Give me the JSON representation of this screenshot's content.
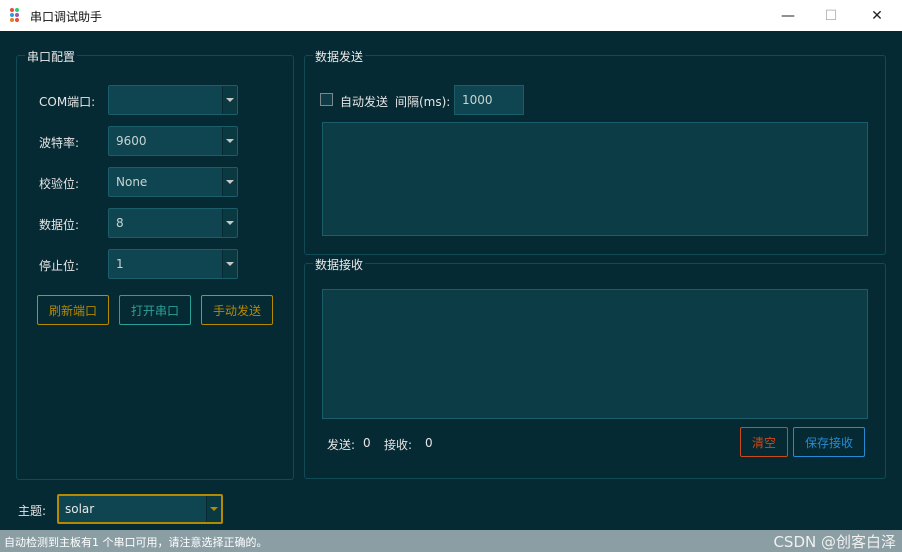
{
  "window": {
    "title": "串口调试助手",
    "controls": {
      "minimize": "—",
      "maximize": "☐",
      "close": "✕"
    }
  },
  "config": {
    "group_title": "串口配置",
    "fields": [
      {
        "label": "COM端口:",
        "value": ""
      },
      {
        "label": "波特率:",
        "value": "9600"
      },
      {
        "label": "校验位:",
        "value": "None"
      },
      {
        "label": "数据位:",
        "value": "8"
      },
      {
        "label": "停止位:",
        "value": "1"
      }
    ],
    "buttons": {
      "refresh": "刷新端口",
      "open": "打开串口",
      "send": "手动发送"
    }
  },
  "send": {
    "group_title": "数据发送",
    "auto_send_label": "自动发送",
    "interval_label": "间隔(ms):",
    "interval_value": "1000",
    "text": ""
  },
  "receive": {
    "group_title": "数据接收",
    "text": "",
    "sent_label": "发送:",
    "sent_count": "0",
    "recv_label": "接收:",
    "recv_count": "0",
    "clear_label": "清空",
    "save_label": "保存接收"
  },
  "theme": {
    "label": "主题:",
    "value": "solar"
  },
  "status": {
    "message": "自动检测到主板有1 个串口可用，请注意选择正确的。",
    "watermark": "CSDN @创客白泽"
  },
  "colors": {
    "background": "#062a34",
    "yellow": "#b58900",
    "cyan": "#2aa198",
    "orange": "#cb4b16",
    "blue": "#268bd2"
  }
}
